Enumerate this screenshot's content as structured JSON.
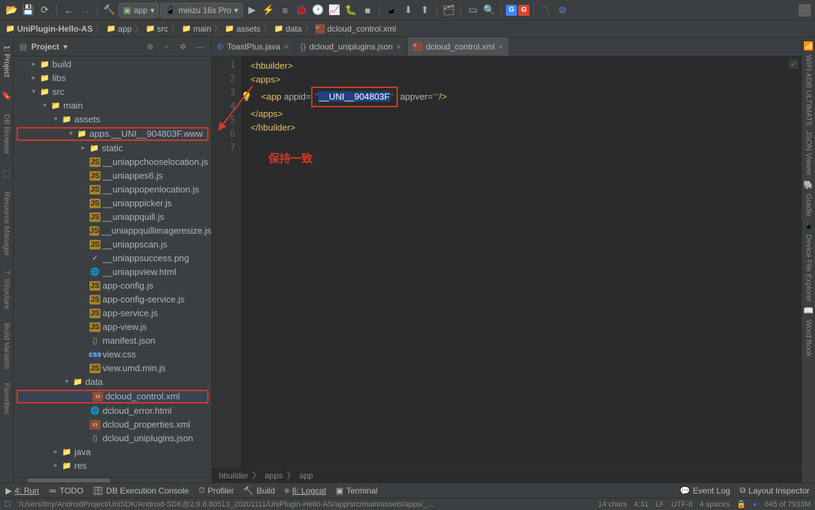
{
  "toolbar": {
    "configs": [
      {
        "icon": "android",
        "label": "app"
      },
      {
        "icon": "device",
        "label": "meizu 16s Pro"
      }
    ]
  },
  "breadcrumbs": [
    "UniPlugin-Hello-AS",
    "app",
    "src",
    "main",
    "assets",
    "data",
    "dcloud_control.xml"
  ],
  "panel": {
    "title": "Project",
    "tree": {
      "build": "build",
      "libs": "libs",
      "src": "src",
      "main": "main",
      "assets": "assets",
      "apps": "apps.__UNI__904803F.www",
      "static": "static",
      "f1": "__uniappchooselocation.js",
      "f2": "__uniappes6.js",
      "f3": "__uniappopenlocation.js",
      "f4": "__uniapppicker.js",
      "f5": "__uniappquill.js",
      "f6": "__uniappquillimageresize.js",
      "f7": "__uniappscan.js",
      "f8": "__uniappsuccess.png",
      "f9": "__uniappview.html",
      "f10": "app-config.js",
      "f11": "app-config-service.js",
      "f12": "app-service.js",
      "f13": "app-view.js",
      "f14": "manifest.json",
      "f15": "view.css",
      "f16": "view.umd.min.js",
      "data": "data",
      "f17": "dcloud_control.xml",
      "f18": "dcloud_error.html",
      "f19": "dcloud_properties.xml",
      "f20": "dcloud_uniplugins.json",
      "java": "java",
      "res": "res"
    }
  },
  "tabs": [
    {
      "icon": "class",
      "label": "ToastPlus.java",
      "active": false
    },
    {
      "icon": "json",
      "label": "dcloud_uniplugins.json",
      "active": false
    },
    {
      "icon": "xml",
      "label": "dcloud_control.xml",
      "active": true
    }
  ],
  "editor": {
    "lines": 7,
    "line1_tag": "hbuilder",
    "line2_tag": "apps",
    "line3_tag": "app",
    "line3_attr1": "appid",
    "line3_val1": "__UNI__904803F",
    "line3_attr2": "appver",
    "line3_val2": "",
    "line4_tag": "/apps",
    "line5_tag": "/hbuilder",
    "annotation": "保持一致",
    "crumb": [
      "hbuilder",
      "apps",
      "app"
    ]
  },
  "gutter_left": [
    "1: Project",
    "DB Browser",
    "Resource Manager",
    "7: Structure",
    "Build Variants",
    "Favorites"
  ],
  "gutter_right": [
    "WIFI ADB ULTIMATE",
    "JSON Viewer",
    "Gradle",
    "Device File Explorer",
    "Word Book"
  ],
  "bottom": {
    "run": "4: Run",
    "todo": "TODO",
    "db": "DB Execution Console",
    "profiler": "Profiler",
    "build": "Build",
    "logcat": "6: Logcat",
    "terminal": "Terminal",
    "eventlog": "Event Log",
    "layout": "Layout Inspector"
  },
  "status": {
    "path": "'/Users/lmy/AndroidProject/UniSDK/Android-SDK@2.9.8.80513_20201111/UniPlugin-Hello-AS/app/src/main/assets/apps/_…",
    "chars": "14 chars",
    "pos": "4:31",
    "lf": "LF",
    "enc": "UTF-8",
    "indent": "4 spaces",
    "mem": "645 of 7933M"
  }
}
